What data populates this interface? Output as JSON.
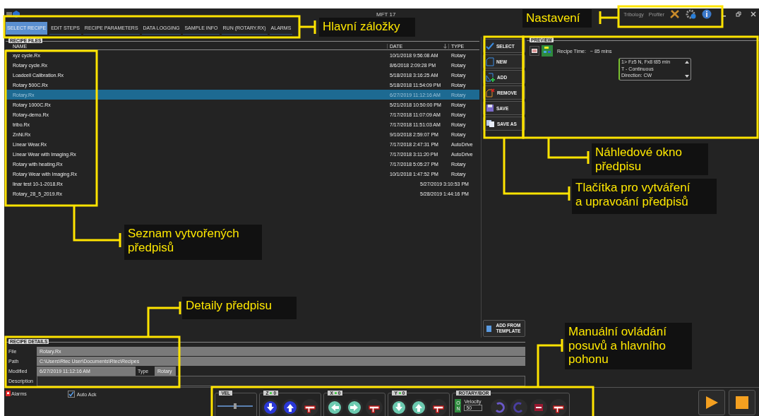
{
  "window": {
    "title": "MFT 17",
    "header_links": [
      "Tribology",
      "Profiler"
    ]
  },
  "tabs": [
    {
      "label": "SELECT RECIPE",
      "selected": true
    },
    {
      "label": "EDIT STEPS",
      "selected": false
    },
    {
      "label": "RECIPE PARAMETERS",
      "selected": false
    },
    {
      "label": "DATA LOGGING",
      "selected": false
    },
    {
      "label": "SAMPLE INFO",
      "selected": false
    },
    {
      "label": "RUN (ROTARY.RX)",
      "selected": false
    },
    {
      "label": "ALARMS",
      "selected": false
    }
  ],
  "recipe_files": {
    "label": "RECIPE FILES",
    "columns": [
      "NAME",
      "DATE",
      "TYPE"
    ],
    "rows": [
      {
        "name": "xyz cycle.Rx",
        "date": "10/1/2018 9:56:08 AM",
        "type": "Rotary",
        "selected": false
      },
      {
        "name": "Rotary cycle.Rx",
        "date": "8/6/2018 2:09:28 PM",
        "type": "Rotary",
        "selected": false
      },
      {
        "name": "Loadcell Calibration.Rx",
        "date": "5/18/2018 3:16:25 AM",
        "type": "Rotary",
        "selected": false
      },
      {
        "name": "Rotary 500C.Rx",
        "date": "5/18/2018 11:54:09 PM",
        "type": "Rotary",
        "selected": false
      },
      {
        "name": "Rotary.Rx",
        "date": "6/27/2019 11:12:16 AM",
        "type": "Rotary",
        "selected": true
      },
      {
        "name": "Rotary 1000C.Rx",
        "date": "5/21/2018 10:50:00 PM",
        "type": "Rotary",
        "selected": false
      },
      {
        "name": "Rotary-demo.Rx",
        "date": "7/17/2018 11:07:09 AM",
        "type": "Rotary",
        "selected": false
      },
      {
        "name": "tribo.Rx",
        "date": "7/17/2018 11:51:03 AM",
        "type": "Rotary",
        "selected": false
      },
      {
        "name": "ZnNi.Rx",
        "date": "9/10/2018 2:59:07 PM",
        "type": "Rotary",
        "selected": false
      },
      {
        "name": "Linear Wear.Rx",
        "date": "7/17/2018 2:47:31 PM",
        "type": "AutoDrive",
        "selected": false
      },
      {
        "name": "Linear Wear with Imaging.Rx",
        "date": "7/17/2018 3:11:20 PM",
        "type": "AutoDrive",
        "selected": false
      },
      {
        "name": "Rotary with heating.Rx",
        "date": "7/17/2018 5:05:27 PM",
        "type": "Rotary",
        "selected": false
      },
      {
        "name": "Rotary Wear with Imaging.Rx",
        "date": "10/1/2018 1:47:52 PM",
        "type": "Rotary",
        "selected": false
      },
      {
        "name": "linar test 10-1-2018.Rx",
        "date": "5/27/2019 3:10:53 PM",
        "selected": false
      },
      {
        "name": "Rotary_28_5_2019.Rx",
        "date": "5/28/2019 1:44:16 PM",
        "selected": false
      }
    ]
  },
  "actions": [
    {
      "label": "SELECT",
      "kind": "select"
    },
    {
      "label": "NEW",
      "kind": "new"
    },
    {
      "label": "ADD",
      "kind": "add"
    },
    {
      "label": "REMOVE",
      "kind": "remove"
    },
    {
      "label": "SAVE",
      "kind": "save"
    },
    {
      "label": "SAVE AS",
      "kind": "saveas"
    }
  ],
  "add_from_template": "ADD FROM TEMPLATE",
  "preview": {
    "label": "PREVIEW",
    "recipe_time_label": "Recipe Time:",
    "recipe_time": "~ 85 mins",
    "steps": [
      "1> Fz5 N, Fx8 t85 min",
      "T - Continuous",
      "Direction: CW"
    ]
  },
  "recipe_details": {
    "label": "RECIPE DETAILS",
    "file_label": "File",
    "file": "Rotary.Rx",
    "path_label": "Path",
    "path": "C:\\Users\\Rtec User\\Documents\\Rtec\\Recipes",
    "modified_label": "Modified",
    "modified": "6/27/2019 11:12:16 AM",
    "type_label": "Type",
    "type": "Rotary",
    "description_label": "Description"
  },
  "status": {
    "alarms": "Alarms",
    "auto_ack": {
      "label": "Auto Ack",
      "checked": true
    }
  },
  "manual_controls": [
    {
      "label": "VEL",
      "kind": "slider",
      "level": 0.5
    },
    {
      "label": "Z",
      "value": "0",
      "kind": "z-axis"
    },
    {
      "label": "X",
      "value": "0",
      "kind": "x-axis"
    },
    {
      "label": "Y",
      "value": "0",
      "kind": "y-axis"
    },
    {
      "label": "ROTARY/BOR",
      "kind": "rotary",
      "switch": "ON",
      "switch_on": true,
      "velocity_label": "Velocity",
      "velocity": "50"
    }
  ],
  "annotations": [
    {
      "text": "Hlavní záložky"
    },
    {
      "text": "Nastavení"
    },
    {
      "text": "Náhledové okno\npředpisu"
    },
    {
      "text": "Tlačítka pro vytváření\na upravoání předpisů"
    },
    {
      "text": "Seznam vytvořených\npředpisů"
    },
    {
      "text": "Detaily předpisu"
    },
    {
      "text": "Manuální ovládání\nposuvů a hlavního\npohonu"
    }
  ]
}
